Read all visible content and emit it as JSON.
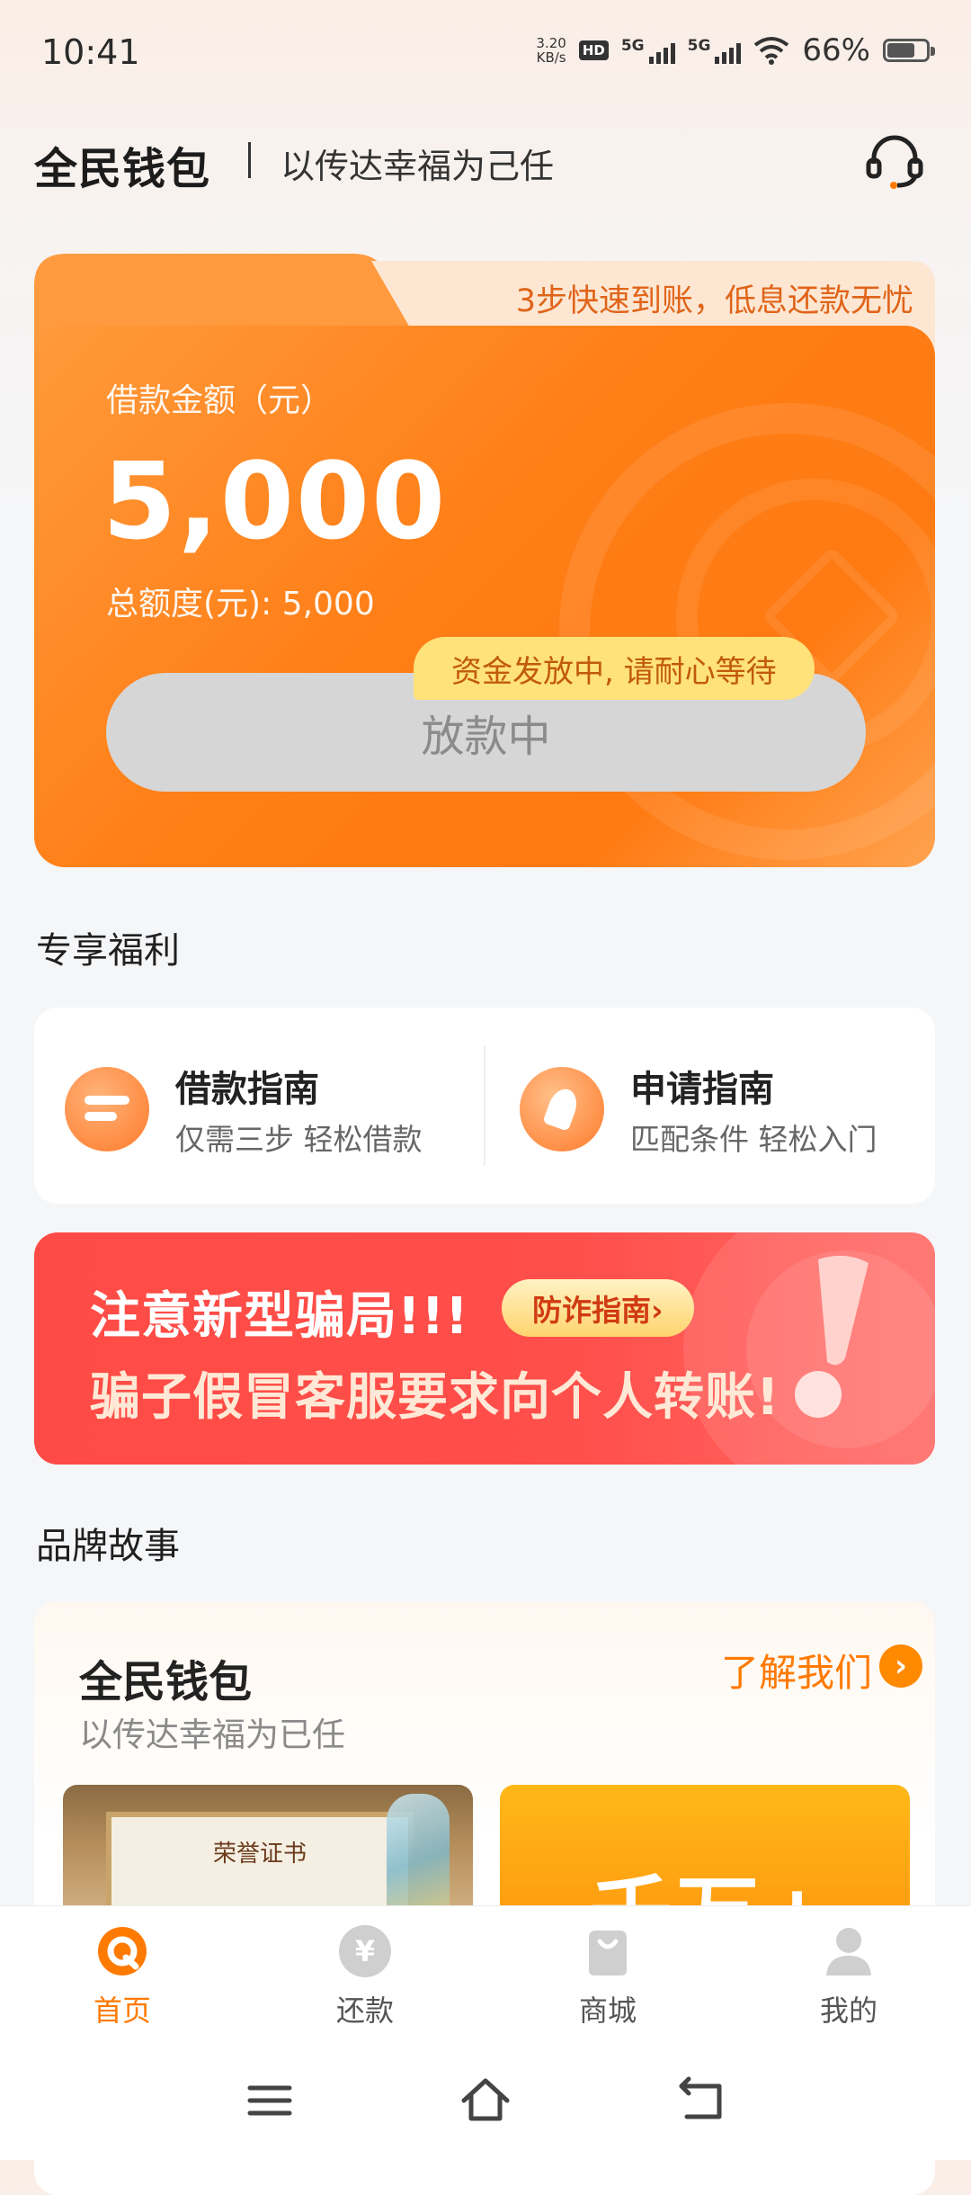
{
  "status_bar": {
    "time": "10:41",
    "net_speed_value": "3.20",
    "net_speed_unit": "KB/s",
    "hd": "HD",
    "net1": "5G",
    "net2": "5G",
    "battery": "66%",
    "battery_level": 0.66
  },
  "header": {
    "brand": "全民钱包",
    "slogan": "以传达幸福为己任",
    "service_icon": "headset-icon"
  },
  "loan_card": {
    "tab_text": "3步快速到账，低息还款无忧",
    "amount_label": "借款金额（元）",
    "amount": "5,000",
    "total_label": "总额度(元): 5,000",
    "button_label": "放款中",
    "tip": "资金发放中, 请耐心等待"
  },
  "benefits": {
    "title": "专享福利",
    "items": [
      {
        "title": "借款指南",
        "subtitle": "仅需三步 轻松借款",
        "icon": "loan-guide-icon"
      },
      {
        "title": "申请指南",
        "subtitle": "匹配条件 轻松入门",
        "icon": "apply-guide-icon"
      }
    ]
  },
  "banner": {
    "line1": "注意新型骗局!!!",
    "line2": "骗子假冒客服要求向个人转账!",
    "button": "防诈指南›"
  },
  "brand_story": {
    "title": "品牌故事",
    "card_title": "全民钱包",
    "card_subtitle": "以传达幸福为已任",
    "link": "了解我们",
    "cert_text": "荣誉证书",
    "big_text": "千万+"
  },
  "bottom_nav": [
    {
      "label": "首页",
      "icon": "home-icon",
      "active": true
    },
    {
      "label": "还款",
      "icon": "yen-icon",
      "active": false
    },
    {
      "label": "商城",
      "icon": "shopping-bag-icon",
      "active": false
    },
    {
      "label": "我的",
      "icon": "profile-icon",
      "active": false
    }
  ],
  "colors": {
    "accent": "#ff7a00",
    "card": "#ff8420",
    "banner": "#ff4b45"
  }
}
